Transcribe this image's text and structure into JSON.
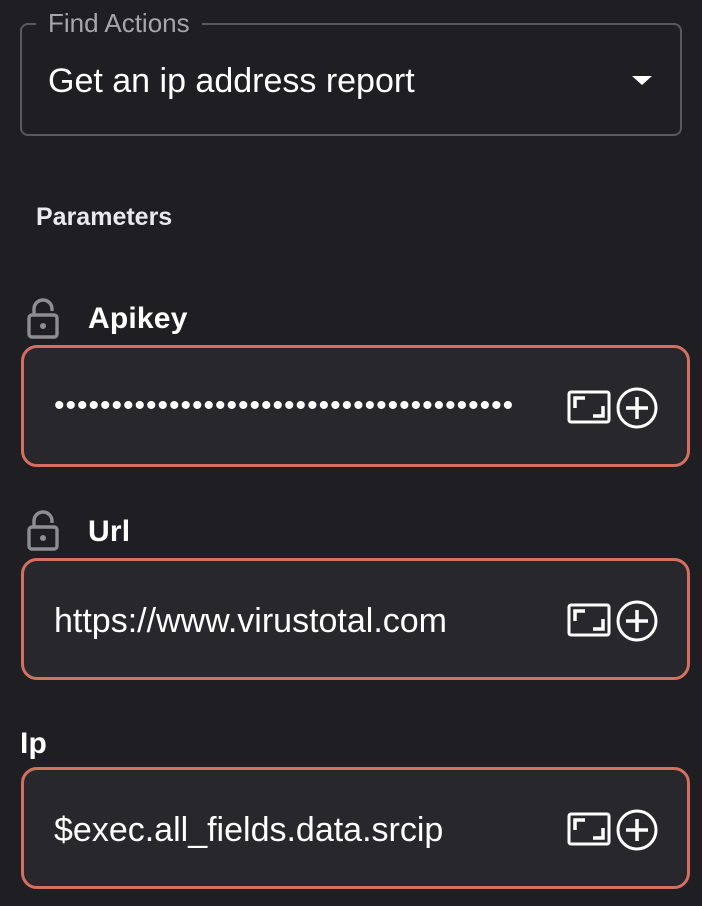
{
  "find_actions": {
    "label": "Find Actions",
    "value": "Get an ip address report"
  },
  "parameters": {
    "title": "Parameters",
    "items": [
      {
        "label": "Apikey",
        "value": "••••••••••••••••••••••••••••••••••••••••",
        "locked": true,
        "masked": true
      },
      {
        "label": "Url",
        "value": "https://www.virustotal.com",
        "locked": true,
        "masked": false
      },
      {
        "label": "Ip",
        "value": "$exec.all_fields.data.srcip",
        "locked": false,
        "masked": false
      }
    ]
  },
  "icons": {
    "dropdown": "caret-down-icon",
    "lock": "lock-icon",
    "expand": "expand-icon",
    "add": "add-circle-icon"
  },
  "colors": {
    "background": "#1f1f23",
    "field_background": "#28282c",
    "field_border": "#d3705f",
    "outline": "#5a5a5e"
  }
}
